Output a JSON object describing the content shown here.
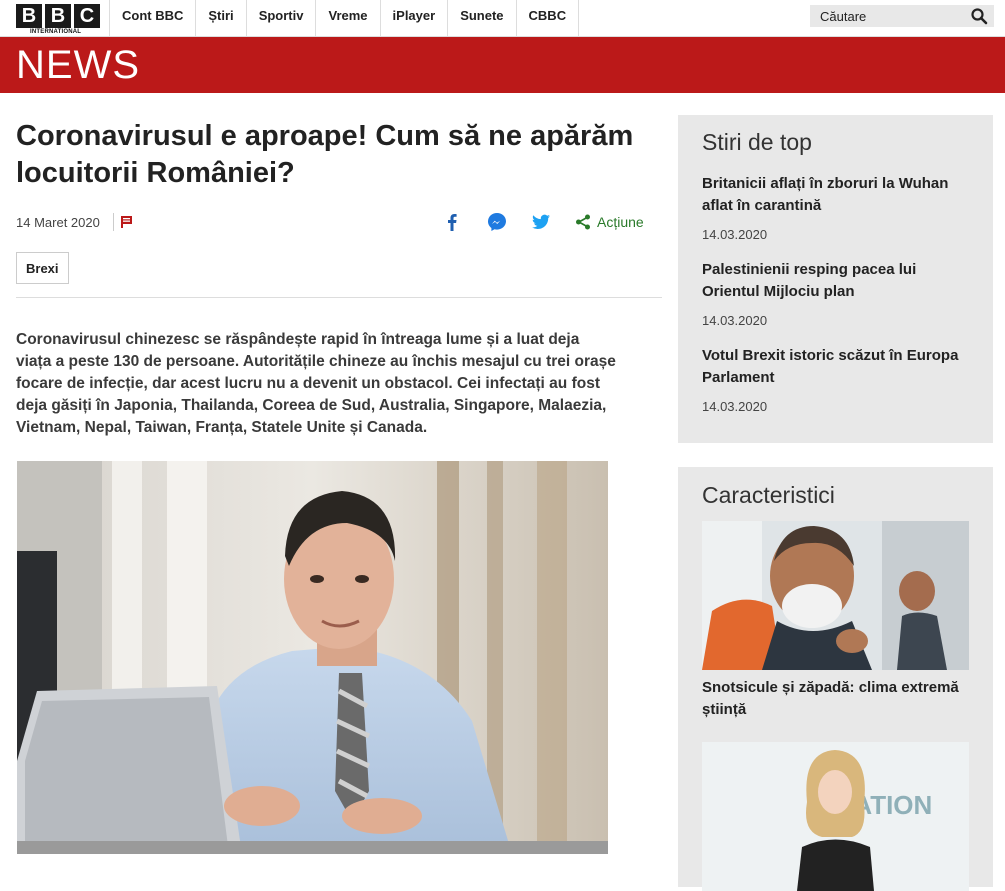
{
  "brand": {
    "logo_letters": [
      "B",
      "B",
      "C"
    ],
    "logo_sub": "INTERNATIONAL",
    "section": "NEWS",
    "accent": "#bb1919"
  },
  "nav": {
    "items": [
      "Cont BBC",
      "Știri",
      "Sportiv",
      "Vreme",
      "iPlayer",
      "Sunete",
      "CBBC"
    ]
  },
  "search": {
    "placeholder": "Căutare",
    "icon": "search-icon"
  },
  "article": {
    "headline": "Coronavirusul e aproape! Cum să ne apărăm locuitorii României?",
    "date": "14 Maret 2020",
    "share_label": "Acțiune",
    "tag": "Brexi",
    "lead": "Coronavirusul chinezesc se răspândește rapid în întreaga lume și a luat deja viața a peste 130 de persoane. Autoritățile chineze au închis mesajul cu trei orașe focare de infecție, dar acest lucru nu a devenit un obstacol. Cei infectați au fost deja găsiți în Japonia, Thailanda, Coreea de Sud, Australia, Singapore, Malaezia, Vietnam, Nepal, Taiwan, Franța, Statele Unite și Canada."
  },
  "sidebar": {
    "top_title": "Stiri de top",
    "top_stories": [
      {
        "title": "Britanicii aflați în zboruri la Wuhan aflat în carantină",
        "date": "14.03.2020"
      },
      {
        "title": "Palestinienii resping pacea lui Orientul Mijlociu plan",
        "date": "14.03.2020"
      },
      {
        "title": "Votul Brexit istoric scăzut în Europa Parlament",
        "date": "14.03.2020"
      }
    ],
    "features_title": "Caracteristici",
    "features": [
      {
        "title": "Snotsicule și zăpadă: clima extremă știință"
      }
    ],
    "thumb_caption_fragment": "S CATION"
  }
}
